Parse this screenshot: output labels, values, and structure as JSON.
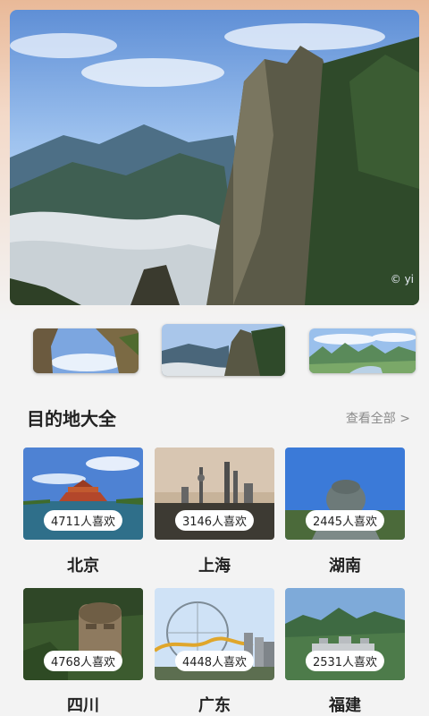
{
  "hero": {
    "watermark": "© yi"
  },
  "section": {
    "title": "目的地大全",
    "see_all": "查看全部 >"
  },
  "thumbs": [
    {
      "name": "arch-rock"
    },
    {
      "name": "mountain-peak"
    },
    {
      "name": "karst-river"
    }
  ],
  "destinations": [
    {
      "city": "北京",
      "likes": "4711人喜欢"
    },
    {
      "city": "上海",
      "likes": "3146人喜欢"
    },
    {
      "city": "湖南",
      "likes": "2445人喜欢"
    },
    {
      "city": "四川",
      "likes": "4768人喜欢"
    },
    {
      "city": "广东",
      "likes": "4448人喜欢"
    },
    {
      "city": "福建",
      "likes": "2531人喜欢"
    }
  ]
}
